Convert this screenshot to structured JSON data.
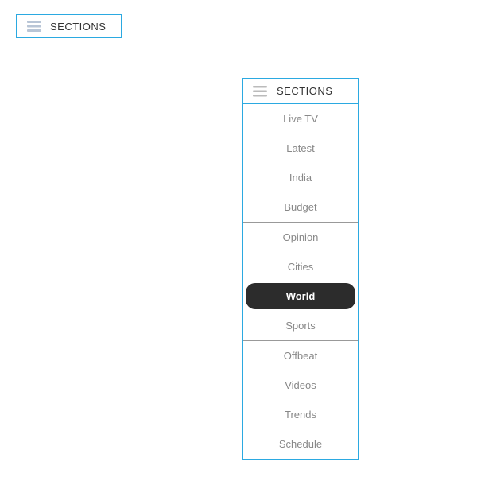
{
  "button": {
    "label": "SECTIONS"
  },
  "dropdown": {
    "header": "SECTIONS",
    "groups": [
      {
        "items": [
          {
            "label": "Live TV",
            "active": false
          },
          {
            "label": "Latest",
            "active": false
          },
          {
            "label": "India",
            "active": false
          },
          {
            "label": "Budget",
            "active": false
          }
        ]
      },
      {
        "items": [
          {
            "label": "Opinion",
            "active": false
          },
          {
            "label": "Cities",
            "active": false
          },
          {
            "label": "World",
            "active": true
          },
          {
            "label": "Sports",
            "active": false
          }
        ]
      },
      {
        "items": [
          {
            "label": "Offbeat",
            "active": false
          },
          {
            "label": "Videos",
            "active": false
          },
          {
            "label": "Trends",
            "active": false
          },
          {
            "label": "Schedule",
            "active": false
          }
        ]
      }
    ]
  }
}
